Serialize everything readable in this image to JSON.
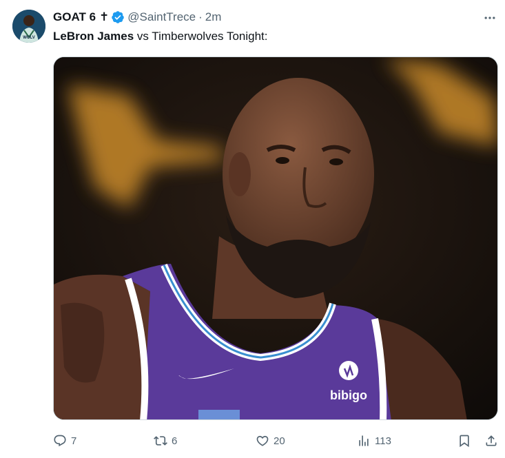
{
  "tweet": {
    "author": {
      "display_name": "GOAT 6",
      "badge_emoji": "✝",
      "verified": true,
      "handle": "@SaintTrece",
      "separator": "·",
      "time": "2m",
      "avatar_icon": "avatar-basketball-player"
    },
    "text": {
      "bold": "LeBron James",
      "rest": " vs Timberwolves Tonight:"
    },
    "media": {
      "description_icon": "photo-basketball-player",
      "jersey_logo_text": "bibigo"
    },
    "actions": {
      "replies": "7",
      "retweets": "6",
      "likes": "20",
      "views": "113"
    }
  },
  "colors": {
    "secondary_text": "#536471",
    "verified_blue": "#1d9bf0",
    "jersey_purple": "#5a3a9a"
  }
}
